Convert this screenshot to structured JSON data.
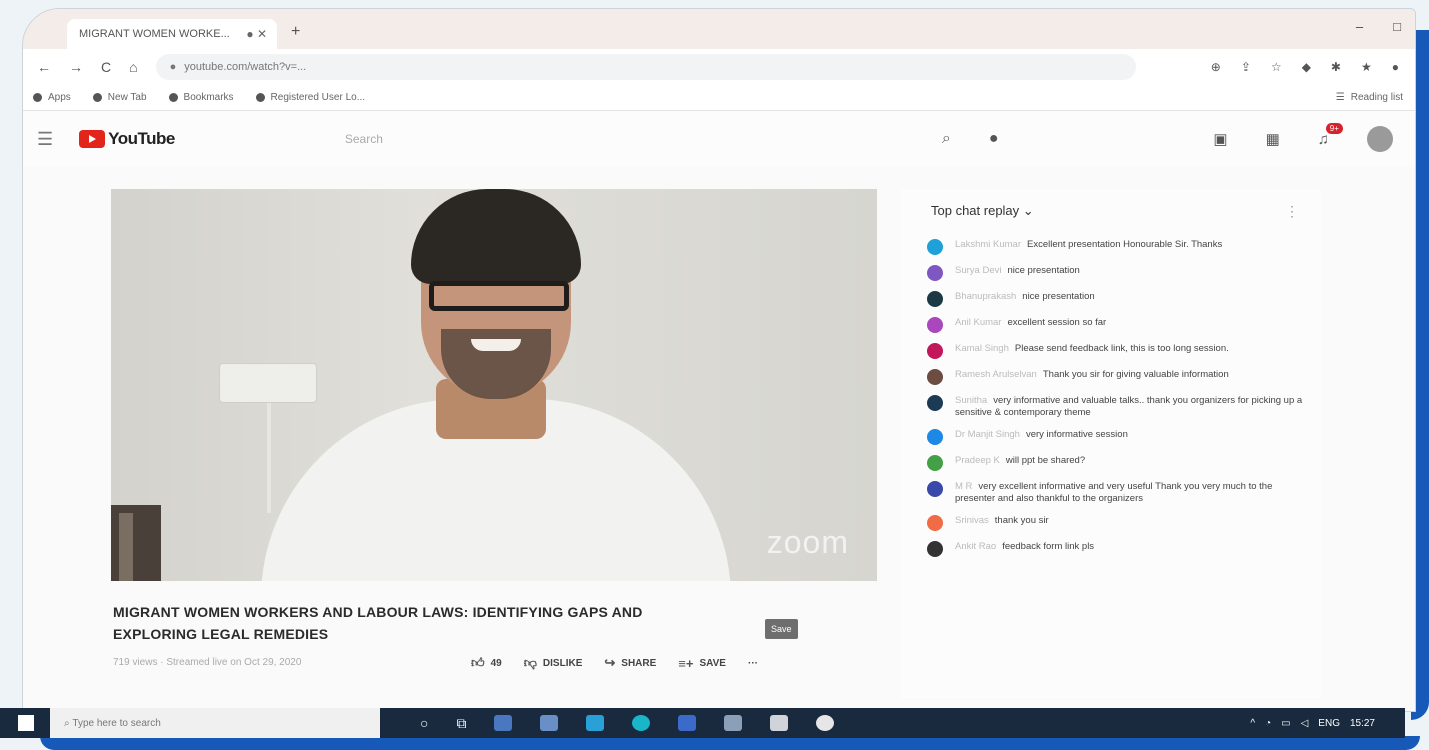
{
  "browser": {
    "tab_title": "MIGRANT WOMEN WORKE...",
    "tab_indicator": "● ✕",
    "new_tab_label": "+",
    "window_controls": [
      "‒",
      "□"
    ],
    "url": "youtube.com/watch?v=...",
    "bookmarks": [
      {
        "label": "Apps"
      },
      {
        "label": "New Tab"
      },
      {
        "label": "Bookmarks"
      },
      {
        "label": "Registered User Lo..."
      }
    ],
    "reading_list": "Reading list"
  },
  "youtube": {
    "logo_text": "YouTube",
    "search_placeholder": "Search",
    "notification_count": "9+"
  },
  "video": {
    "watermark": "zoom",
    "title_line1": "MIGRANT WOMEN WORKERS AND LABOUR LAWS: IDENTIFYING GAPS AND",
    "title_line2": "EXPLORING LEGAL REMEDIES",
    "meta": "719 views · Streamed live on Oct 29, 2020",
    "like_count": "49",
    "dislike_label": "DISLIKE",
    "share_label": "SHARE",
    "save_label": "SAVE",
    "more_label": "···",
    "tooltip": "Save"
  },
  "chat": {
    "header": "Top chat replay",
    "messages": [
      {
        "author": "Lakshmi Kumar",
        "text": "Excellent presentation Honourable Sir. Thanks",
        "color": "#1ea0d8"
      },
      {
        "author": "Surya Devi",
        "text": "nice presentation",
        "color": "#7e57c2"
      },
      {
        "author": "Bhanuprakash",
        "text": "nice presentation",
        "color": "#1d3a44"
      },
      {
        "author": "Anil Kumar",
        "text": "excellent session so far",
        "color": "#ab47bc"
      },
      {
        "author": "Kamal Singh",
        "text": "Please send feedback link, this is too long session.",
        "color": "#c2185b"
      },
      {
        "author": "Ramesh Arulselvan",
        "text": "Thank you sir for giving valuable information",
        "color": "#6d4c41"
      },
      {
        "author": "Sunitha",
        "text": "very informative and valuable talks.. thank you organizers for picking up a sensitive & contemporary theme",
        "color": "#1d3a55"
      },
      {
        "author": "Dr Manjit Singh",
        "text": "very informative session",
        "color": "#1e88e5"
      },
      {
        "author": "Pradeep K",
        "text": "will ppt be shared?",
        "color": "#43a047"
      },
      {
        "author": "M R",
        "text": "very excellent informative and very useful Thank you very much to the presenter and also thankful to the organizers",
        "color": "#3949ab"
      },
      {
        "author": "Srinivas",
        "text": "thank you sir",
        "color": "#ef6c45"
      },
      {
        "author": "Ankit Rao",
        "text": "feedback form link pls",
        "color": "#333333"
      }
    ]
  },
  "taskbar": {
    "search_placeholder": "Type here to search",
    "time": "15:27"
  }
}
